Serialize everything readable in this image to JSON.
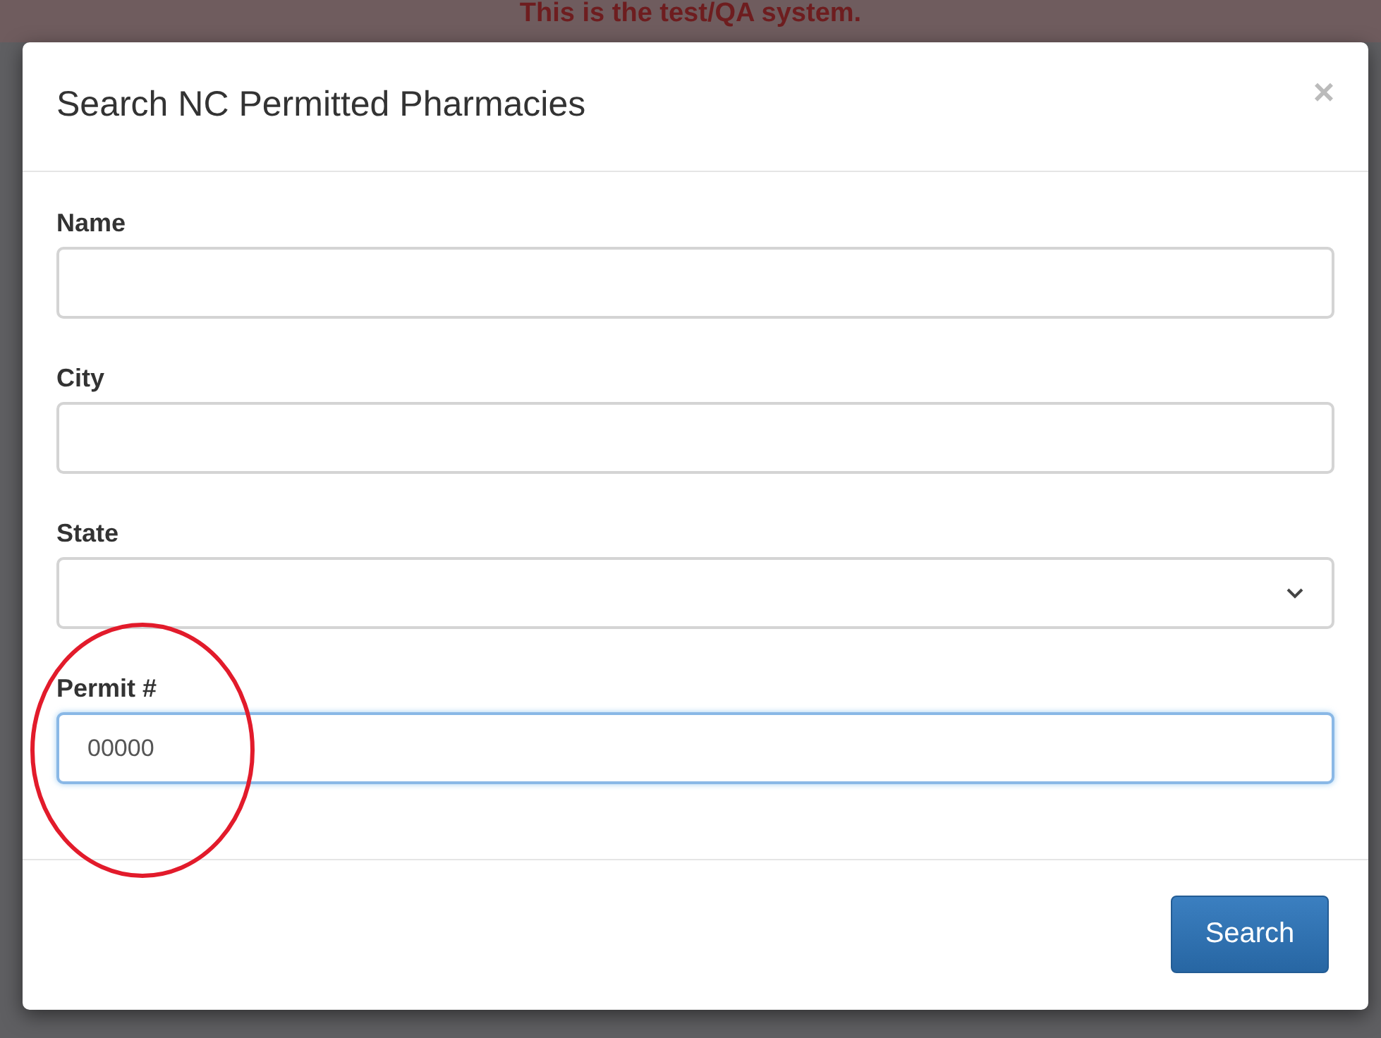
{
  "banner": {
    "text": "This is the test/QA system."
  },
  "dialog": {
    "title": "Search NC Permitted Pharmacies",
    "close": "×",
    "fields": [
      {
        "label": "Name",
        "kind": "text",
        "focused": false
      },
      {
        "label": "City",
        "kind": "text",
        "focused": false
      },
      {
        "label": "State",
        "kind": "select",
        "focused": false
      },
      {
        "label": "Permit #",
        "kind": "text",
        "value": "00000",
        "focused": true
      }
    ],
    "buttons": [
      "Search"
    ]
  }
}
